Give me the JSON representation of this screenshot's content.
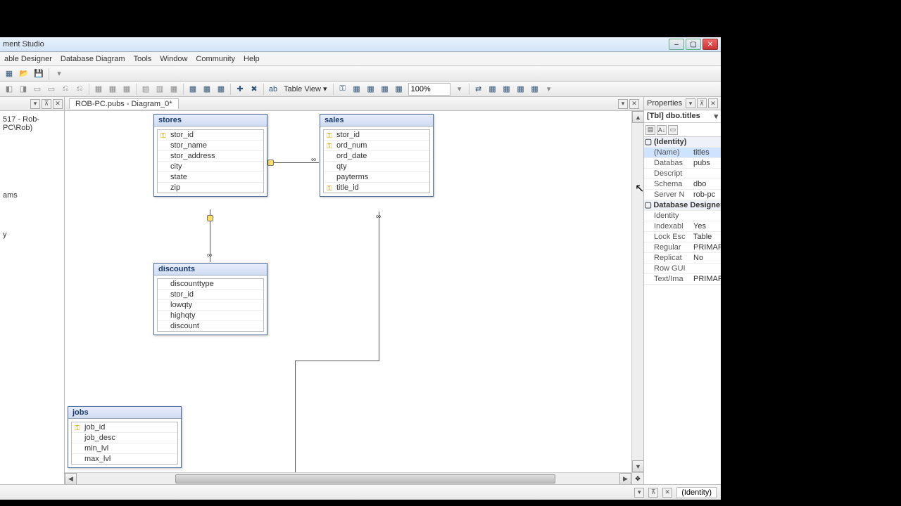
{
  "app": {
    "title": "ment Studio"
  },
  "menu": {
    "designer": "able Designer",
    "diagram": "Database Diagram",
    "tools": "Tools",
    "window": "Window",
    "community": "Community",
    "help": "Help"
  },
  "toolbar": {
    "table_view": "Table View ▾",
    "zoom": "100%"
  },
  "left": {
    "server": "517 - Rob-PC\\Rob)",
    "node1": "ams",
    "node2": "y"
  },
  "doc": {
    "tab": "ROB-PC.pubs - Diagram_0*"
  },
  "tables": {
    "stores": {
      "name": "stores",
      "cols": [
        {
          "k": true,
          "n": "stor_id"
        },
        {
          "k": false,
          "n": "stor_name"
        },
        {
          "k": false,
          "n": "stor_address"
        },
        {
          "k": false,
          "n": "city"
        },
        {
          "k": false,
          "n": "state"
        },
        {
          "k": false,
          "n": "zip"
        }
      ]
    },
    "sales": {
      "name": "sales",
      "cols": [
        {
          "k": true,
          "n": "stor_id"
        },
        {
          "k": true,
          "n": "ord_num"
        },
        {
          "k": false,
          "n": "ord_date"
        },
        {
          "k": false,
          "n": "qty"
        },
        {
          "k": false,
          "n": "payterms"
        },
        {
          "k": true,
          "n": "title_id"
        }
      ]
    },
    "discounts": {
      "name": "discounts",
      "cols": [
        {
          "k": false,
          "n": "discounttype"
        },
        {
          "k": false,
          "n": "stor_id"
        },
        {
          "k": false,
          "n": "lowqty"
        },
        {
          "k": false,
          "n": "highqty"
        },
        {
          "k": false,
          "n": "discount"
        }
      ]
    },
    "jobs": {
      "name": "jobs",
      "cols": [
        {
          "k": true,
          "n": "job_id"
        },
        {
          "k": false,
          "n": "job_desc"
        },
        {
          "k": false,
          "n": "min_lvl"
        },
        {
          "k": false,
          "n": "max_lvl"
        }
      ]
    }
  },
  "properties": {
    "title": "Properties",
    "obj": "[Tbl] dbo.titles",
    "cats": [
      {
        "cat": "(Identity)",
        "rows": [
          {
            "k": "(Name)",
            "v": "titles",
            "sel": true
          },
          {
            "k": "Databas",
            "v": "pubs"
          },
          {
            "k": "Descript",
            "v": ""
          },
          {
            "k": "Schema",
            "v": "dbo"
          },
          {
            "k": "Server N",
            "v": "rob-pc"
          }
        ]
      },
      {
        "cat": "Database Designer",
        "rows": [
          {
            "k": "Identity",
            "v": ""
          },
          {
            "k": "Indexabl",
            "v": "Yes"
          },
          {
            "k": "Lock Esc",
            "v": "Table"
          },
          {
            "k": "Regular",
            "v": "PRIMARY"
          },
          {
            "k": "Replicat",
            "v": "No"
          },
          {
            "k": "Row GUI",
            "v": ""
          },
          {
            "k": "Text/Ima",
            "v": "PRIMARY"
          }
        ]
      }
    ],
    "help": "(Identity)"
  }
}
